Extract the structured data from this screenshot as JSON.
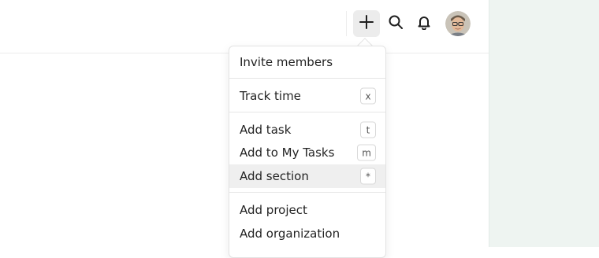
{
  "topbar": {
    "add_icon": "plus-icon",
    "search_icon": "search-icon",
    "bell_icon": "bell-icon",
    "avatar": "user-avatar"
  },
  "menu": {
    "items": [
      {
        "label": "Invite members",
        "shortcut": ""
      },
      {
        "label": "Track time",
        "shortcut": "x"
      },
      {
        "label": "Add task",
        "shortcut": "t"
      },
      {
        "label": "Add to My Tasks",
        "shortcut": "m"
      },
      {
        "label": "Add section",
        "shortcut": "*"
      },
      {
        "label": "Add project",
        "shortcut": ""
      },
      {
        "label": "Add organization",
        "shortcut": ""
      }
    ]
  },
  "colors": {
    "gutter": "#eef4f1",
    "hover": "#efefef",
    "add_button_bg": "#ececec"
  }
}
